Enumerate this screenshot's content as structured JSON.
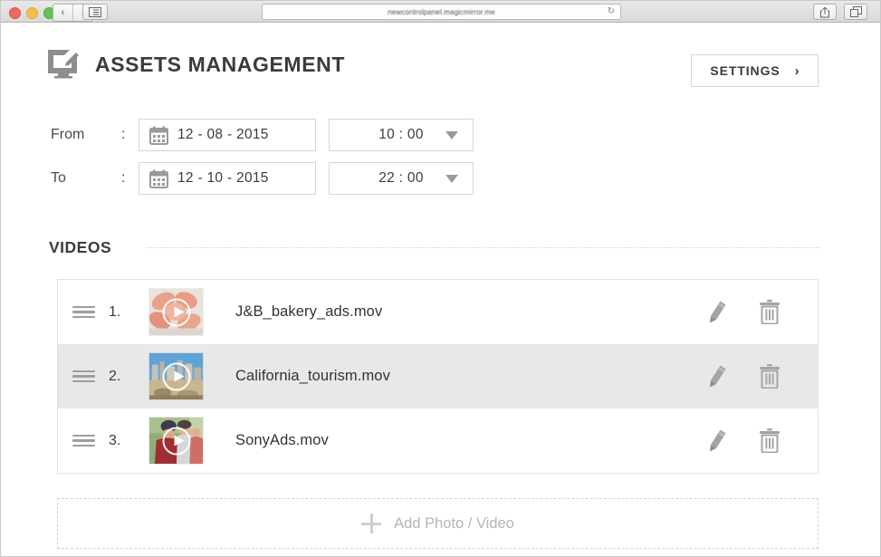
{
  "browser": {
    "url": "newcontrolpanel.magicmirror.me",
    "back_icon": "‹",
    "forward_icon": "›",
    "reload_icon": "↻",
    "sidebar_icon": "sidebar-icon",
    "share_icon": "share-icon",
    "tabs_icon": "tabs-icon"
  },
  "header": {
    "title": "ASSETS MANAGEMENT",
    "icon": "screen-edit-icon",
    "settings_label": "SETTINGS",
    "settings_chevron": "›"
  },
  "form": {
    "rows": [
      {
        "label": "From",
        "colon": ":",
        "date": "12 - 08 - 2015",
        "time": "10 : 00",
        "calendar_icon": "calendar-icon"
      },
      {
        "label": "To",
        "colon": ":",
        "date": "12 - 10 - 2015",
        "time": "22 : 00",
        "calendar_icon": "calendar-icon"
      }
    ]
  },
  "videos_section": {
    "title": "VIDEOS",
    "items": [
      {
        "index": "1.",
        "name": "J&B_bakery_ads.mov",
        "thumbnail": "strawberries-pastry",
        "selected": false,
        "edit_icon": "pencil-icon",
        "delete_icon": "trash-icon",
        "drag_icon": "drag-handle-icon",
        "play_icon": "play-icon"
      },
      {
        "index": "2.",
        "name": "California_tourism.mov",
        "thumbnail": "city-skyline-blue-sky",
        "selected": true,
        "edit_icon": "pencil-icon",
        "delete_icon": "trash-icon",
        "drag_icon": "drag-handle-icon",
        "play_icon": "play-icon"
      },
      {
        "index": "3.",
        "name": "SonyAds.mov",
        "thumbnail": "people-outdoors-red-shirt",
        "selected": false,
        "edit_icon": "pencil-icon",
        "delete_icon": "trash-icon",
        "drag_icon": "drag-handle-icon",
        "play_icon": "play-icon"
      }
    ],
    "add_label": "Add Photo / Video",
    "add_icon": "plus-icon"
  },
  "colors": {
    "text_dark": "#3b3b3b",
    "border": "#d6d6d6",
    "row_selected": "#e8e8e8",
    "muted": "#b5b5b5",
    "icon_gray": "#9e9e9e"
  }
}
